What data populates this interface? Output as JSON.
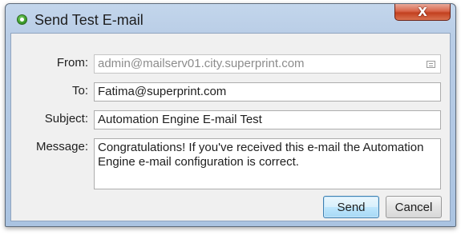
{
  "window": {
    "title": "Send Test E-mail",
    "close_glyph": "X"
  },
  "form": {
    "from": {
      "label": "From:",
      "value": "admin@mailserv01.city.superprint.com",
      "icon": "address-book-icon"
    },
    "to": {
      "label": "To:",
      "value": "Fatima@superprint.com"
    },
    "subject": {
      "label": "Subject:",
      "value": "Automation Engine E-mail Test"
    },
    "message": {
      "label": "Message:",
      "value": "Congratulations! If you've received this e-mail the Automation Engine e-mail configuration is correct."
    }
  },
  "buttons": {
    "send_label": "Send",
    "cancel_label": "Cancel"
  },
  "colors": {
    "titlebar": "#b9cde6",
    "close_button": "#c3401f",
    "content_bg": "#f0f0f0",
    "primary_button_border": "#3c7fb1"
  }
}
